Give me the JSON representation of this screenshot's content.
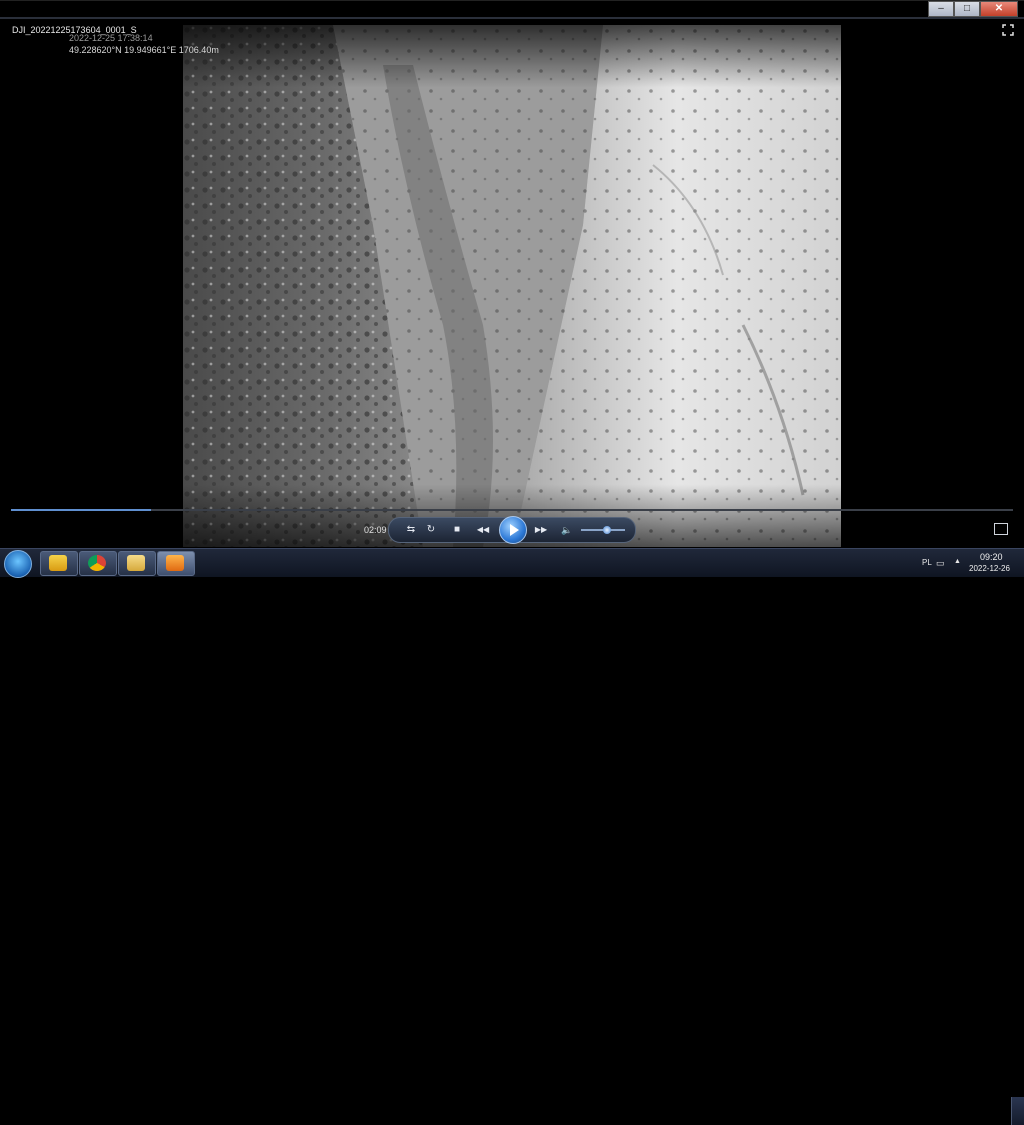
{
  "window": {
    "file_title": "DJI_20221225173604_0001_S",
    "controls": {
      "minimize": "–",
      "maximize": "□",
      "close": "✕"
    }
  },
  "osd": {
    "datetime": "2022-12-25 17:38:14",
    "gps": "49.228620°N 19.949661°E 1706.40m"
  },
  "player": {
    "elapsed": "02:09",
    "progress_percent": 14,
    "volume_percent": 60,
    "buttons": {
      "switch_view": "⇆",
      "repeat": "↻",
      "stop": "■",
      "previous": "◀◀",
      "next": "▶▶",
      "volume": "🔈"
    }
  },
  "taskbar": {
    "apps": [
      "start-orb",
      "contacts-app",
      "chrome",
      "file-explorer",
      "media-player"
    ],
    "language": "PL",
    "clock_time": "09:20",
    "clock_date": "2022-12-26"
  },
  "colors": {
    "accent": "#2c78d6",
    "seek_fill": "#5f8fd0",
    "taskbar": "#141b2b"
  }
}
